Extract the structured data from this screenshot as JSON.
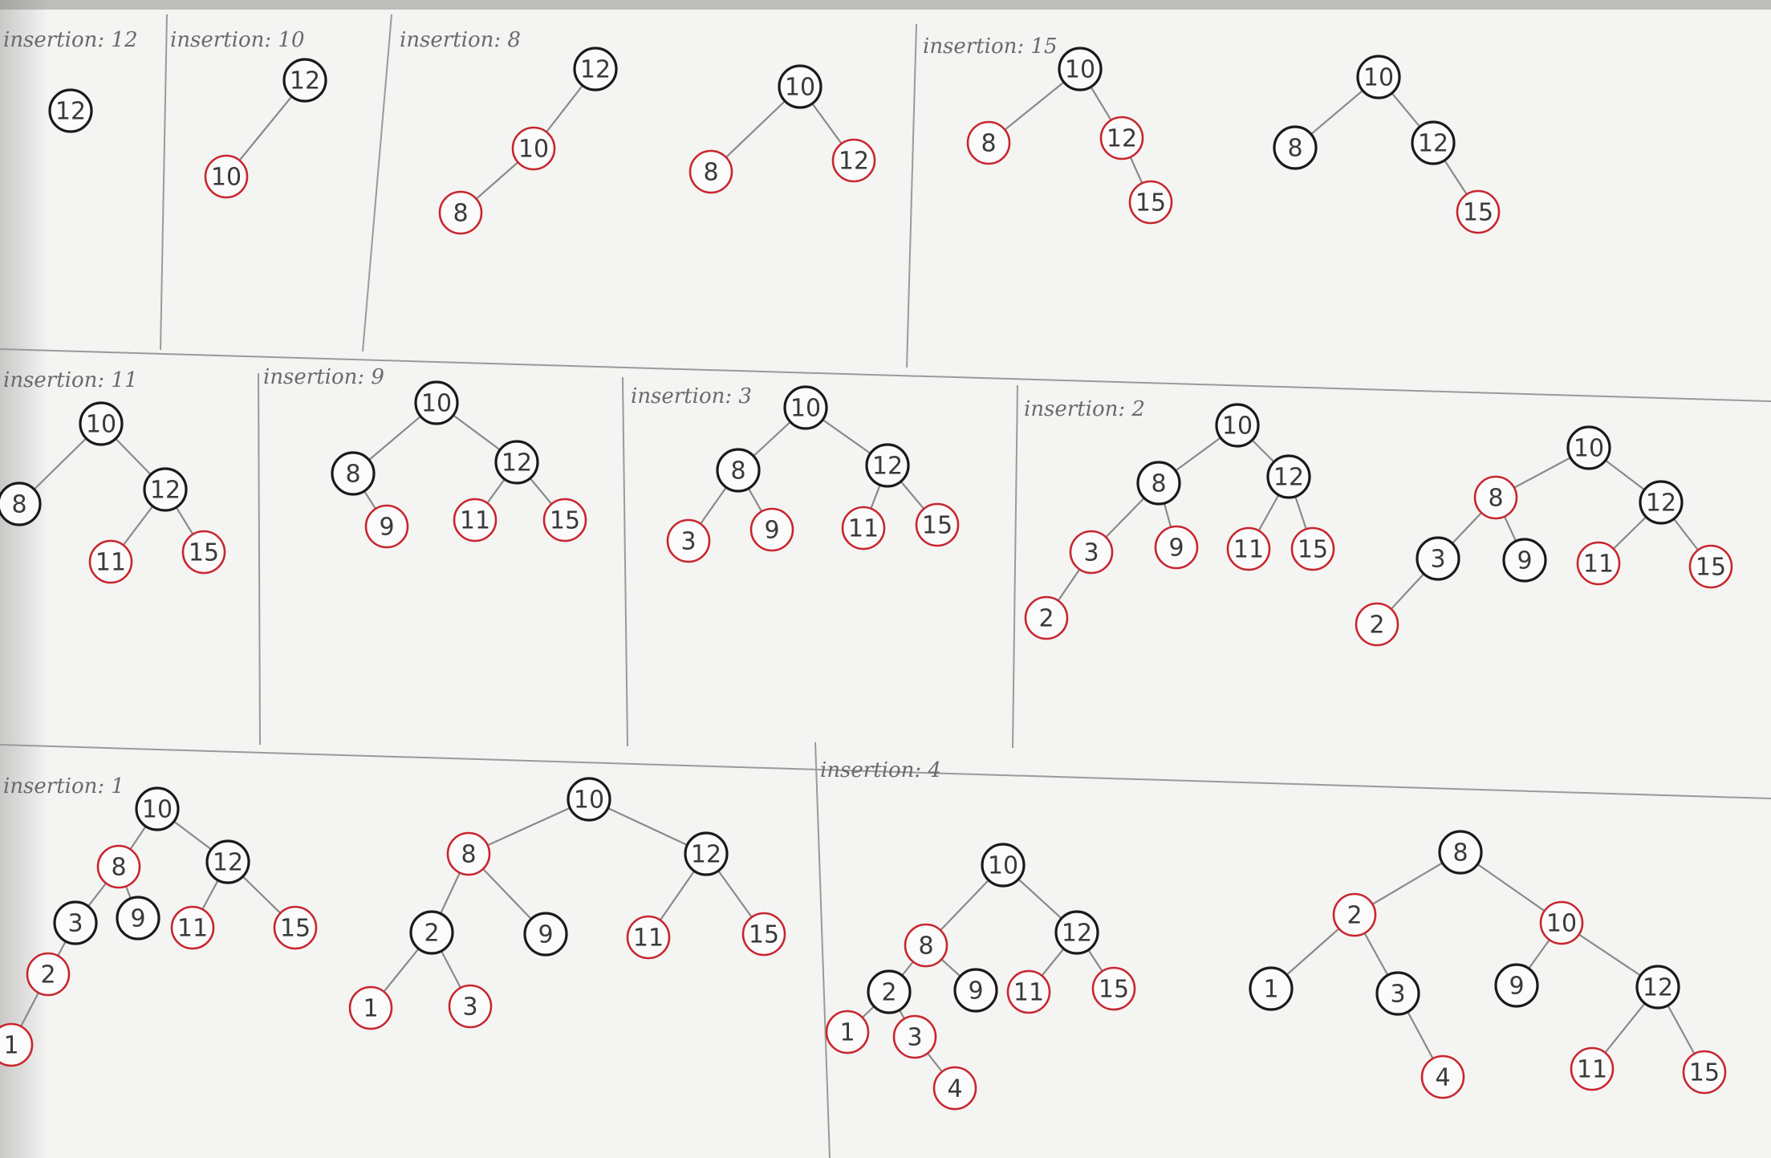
{
  "panels": [
    {
      "label": "insertion: 12",
      "trees": [
        {
          "nodes": [
            {
              "id": "a",
              "v": "12",
              "c": "black"
            }
          ],
          "edges": []
        }
      ]
    },
    {
      "label": "insertion: 10",
      "trees": [
        {
          "nodes": [
            {
              "id": "a",
              "v": "12",
              "c": "black"
            },
            {
              "id": "b",
              "v": "10",
              "c": "red"
            }
          ],
          "edges": [
            [
              "a",
              "b"
            ]
          ]
        }
      ]
    },
    {
      "label": "insertion: 8",
      "trees": [
        {
          "nodes": [
            {
              "id": "a",
              "v": "12",
              "c": "black"
            },
            {
              "id": "b",
              "v": "10",
              "c": "red"
            },
            {
              "id": "c",
              "v": "8",
              "c": "red"
            }
          ],
          "edges": [
            [
              "a",
              "b"
            ],
            [
              "b",
              "c"
            ]
          ]
        },
        {
          "nodes": [
            {
              "id": "a",
              "v": "10",
              "c": "black"
            },
            {
              "id": "b",
              "v": "8",
              "c": "red"
            },
            {
              "id": "c",
              "v": "12",
              "c": "red"
            }
          ],
          "edges": [
            [
              "a",
              "b"
            ],
            [
              "a",
              "c"
            ]
          ]
        }
      ]
    },
    {
      "label": "insertion: 15",
      "trees": [
        {
          "nodes": [
            {
              "id": "a",
              "v": "10",
              "c": "black"
            },
            {
              "id": "b",
              "v": "8",
              "c": "red"
            },
            {
              "id": "c",
              "v": "12",
              "c": "red"
            },
            {
              "id": "d",
              "v": "15",
              "c": "red"
            }
          ],
          "edges": [
            [
              "a",
              "b"
            ],
            [
              "a",
              "c"
            ],
            [
              "c",
              "d"
            ]
          ]
        },
        {
          "nodes": [
            {
              "id": "a",
              "v": "10",
              "c": "black"
            },
            {
              "id": "b",
              "v": "8",
              "c": "black"
            },
            {
              "id": "c",
              "v": "12",
              "c": "black"
            },
            {
              "id": "d",
              "v": "15",
              "c": "red"
            }
          ],
          "edges": [
            [
              "a",
              "b"
            ],
            [
              "a",
              "c"
            ],
            [
              "c",
              "d"
            ]
          ]
        }
      ]
    },
    {
      "label": "insertion: 11",
      "trees": [
        {
          "nodes": [
            {
              "id": "a",
              "v": "10",
              "c": "black"
            },
            {
              "id": "b",
              "v": "8",
              "c": "black"
            },
            {
              "id": "c",
              "v": "12",
              "c": "black"
            },
            {
              "id": "d",
              "v": "11",
              "c": "red"
            },
            {
              "id": "e",
              "v": "15",
              "c": "red"
            }
          ],
          "edges": [
            [
              "a",
              "b"
            ],
            [
              "a",
              "c"
            ],
            [
              "c",
              "d"
            ],
            [
              "c",
              "e"
            ]
          ]
        }
      ]
    },
    {
      "label": "insertion: 9",
      "trees": [
        {
          "nodes": [
            {
              "id": "a",
              "v": "10",
              "c": "black"
            },
            {
              "id": "b",
              "v": "8",
              "c": "black"
            },
            {
              "id": "c",
              "v": "12",
              "c": "black"
            },
            {
              "id": "d",
              "v": "9",
              "c": "red"
            },
            {
              "id": "e",
              "v": "11",
              "c": "red"
            },
            {
              "id": "f",
              "v": "15",
              "c": "red"
            }
          ],
          "edges": [
            [
              "a",
              "b"
            ],
            [
              "a",
              "c"
            ],
            [
              "b",
              "d"
            ],
            [
              "c",
              "e"
            ],
            [
              "c",
              "f"
            ]
          ]
        }
      ]
    },
    {
      "label": "insertion: 3",
      "trees": [
        {
          "nodes": [
            {
              "id": "a",
              "v": "10",
              "c": "black"
            },
            {
              "id": "b",
              "v": "8",
              "c": "black"
            },
            {
              "id": "c",
              "v": "12",
              "c": "black"
            },
            {
              "id": "d",
              "v": "3",
              "c": "red"
            },
            {
              "id": "e",
              "v": "9",
              "c": "red"
            },
            {
              "id": "f",
              "v": "11",
              "c": "red"
            },
            {
              "id": "g",
              "v": "15",
              "c": "red"
            }
          ],
          "edges": [
            [
              "a",
              "b"
            ],
            [
              "a",
              "c"
            ],
            [
              "b",
              "d"
            ],
            [
              "b",
              "e"
            ],
            [
              "c",
              "f"
            ],
            [
              "c",
              "g"
            ]
          ]
        }
      ]
    },
    {
      "label": "insertion: 2",
      "trees": [
        {
          "nodes": [
            {
              "id": "a",
              "v": "10",
              "c": "black"
            },
            {
              "id": "b",
              "v": "8",
              "c": "black"
            },
            {
              "id": "c",
              "v": "12",
              "c": "black"
            },
            {
              "id": "d",
              "v": "3",
              "c": "red"
            },
            {
              "id": "e",
              "v": "9",
              "c": "red"
            },
            {
              "id": "f",
              "v": "11",
              "c": "red"
            },
            {
              "id": "g",
              "v": "15",
              "c": "red"
            },
            {
              "id": "h",
              "v": "2",
              "c": "red"
            }
          ],
          "edges": [
            [
              "a",
              "b"
            ],
            [
              "a",
              "c"
            ],
            [
              "b",
              "d"
            ],
            [
              "b",
              "e"
            ],
            [
              "c",
              "f"
            ],
            [
              "c",
              "g"
            ],
            [
              "d",
              "h"
            ]
          ]
        },
        {
          "nodes": [
            {
              "id": "a",
              "v": "10",
              "c": "black"
            },
            {
              "id": "b",
              "v": "8",
              "c": "red"
            },
            {
              "id": "c",
              "v": "12",
              "c": "black"
            },
            {
              "id": "d",
              "v": "3",
              "c": "black"
            },
            {
              "id": "e",
              "v": "9",
              "c": "black"
            },
            {
              "id": "f",
              "v": "11",
              "c": "red"
            },
            {
              "id": "g",
              "v": "15",
              "c": "red"
            },
            {
              "id": "h",
              "v": "2",
              "c": "red"
            }
          ],
          "edges": [
            [
              "a",
              "b"
            ],
            [
              "a",
              "c"
            ],
            [
              "b",
              "d"
            ],
            [
              "b",
              "e"
            ],
            [
              "c",
              "f"
            ],
            [
              "c",
              "g"
            ],
            [
              "d",
              "h"
            ]
          ]
        }
      ]
    },
    {
      "label": "insertion: 1",
      "trees": [
        {
          "nodes": [
            {
              "id": "a",
              "v": "10",
              "c": "black"
            },
            {
              "id": "b",
              "v": "8",
              "c": "red"
            },
            {
              "id": "c",
              "v": "12",
              "c": "black"
            },
            {
              "id": "d",
              "v": "3",
              "c": "black"
            },
            {
              "id": "e",
              "v": "9",
              "c": "black"
            },
            {
              "id": "f",
              "v": "11",
              "c": "red"
            },
            {
              "id": "g",
              "v": "15",
              "c": "red"
            },
            {
              "id": "h",
              "v": "2",
              "c": "red"
            },
            {
              "id": "i",
              "v": "1",
              "c": "red"
            }
          ],
          "edges": [
            [
              "a",
              "b"
            ],
            [
              "a",
              "c"
            ],
            [
              "b",
              "d"
            ],
            [
              "b",
              "e"
            ],
            [
              "c",
              "f"
            ],
            [
              "c",
              "g"
            ],
            [
              "d",
              "h"
            ],
            [
              "h",
              "i"
            ]
          ]
        },
        {
          "nodes": [
            {
              "id": "a",
              "v": "10",
              "c": "black"
            },
            {
              "id": "b",
              "v": "8",
              "c": "red"
            },
            {
              "id": "c",
              "v": "12",
              "c": "black"
            },
            {
              "id": "d",
              "v": "2",
              "c": "black"
            },
            {
              "id": "e",
              "v": "9",
              "c": "black"
            },
            {
              "id": "f",
              "v": "11",
              "c": "red"
            },
            {
              "id": "g",
              "v": "15",
              "c": "red"
            },
            {
              "id": "h",
              "v": "1",
              "c": "red"
            },
            {
              "id": "i",
              "v": "3",
              "c": "red"
            }
          ],
          "edges": [
            [
              "a",
              "b"
            ],
            [
              "a",
              "c"
            ],
            [
              "b",
              "d"
            ],
            [
              "b",
              "e"
            ],
            [
              "c",
              "f"
            ],
            [
              "c",
              "g"
            ],
            [
              "d",
              "h"
            ],
            [
              "d",
              "i"
            ]
          ]
        }
      ]
    },
    {
      "label": "insertion: 4",
      "trees": [
        {
          "nodes": [
            {
              "id": "a",
              "v": "10",
              "c": "black"
            },
            {
              "id": "b",
              "v": "8",
              "c": "red"
            },
            {
              "id": "c",
              "v": "12",
              "c": "black"
            },
            {
              "id": "d",
              "v": "2",
              "c": "black"
            },
            {
              "id": "e",
              "v": "9",
              "c": "black"
            },
            {
              "id": "f",
              "v": "11",
              "c": "red"
            },
            {
              "id": "g",
              "v": "15",
              "c": "red"
            },
            {
              "id": "h",
              "v": "1",
              "c": "red"
            },
            {
              "id": "i",
              "v": "3",
              "c": "red"
            },
            {
              "id": "j",
              "v": "4",
              "c": "red"
            }
          ],
          "edges": [
            [
              "a",
              "b"
            ],
            [
              "a",
              "c"
            ],
            [
              "b",
              "d"
            ],
            [
              "b",
              "e"
            ],
            [
              "c",
              "f"
            ],
            [
              "c",
              "g"
            ],
            [
              "d",
              "h"
            ],
            [
              "d",
              "i"
            ],
            [
              "i",
              "j"
            ]
          ]
        },
        {
          "nodes": [
            {
              "id": "a",
              "v": "8",
              "c": "black"
            },
            {
              "id": "b",
              "v": "2",
              "c": "red"
            },
            {
              "id": "c",
              "v": "10",
              "c": "red"
            },
            {
              "id": "d",
              "v": "1",
              "c": "black"
            },
            {
              "id": "e",
              "v": "3",
              "c": "black"
            },
            {
              "id": "f",
              "v": "9",
              "c": "black"
            },
            {
              "id": "g",
              "v": "12",
              "c": "black"
            },
            {
              "id": "h",
              "v": "4",
              "c": "red"
            },
            {
              "id": "i",
              "v": "11",
              "c": "red"
            },
            {
              "id": "j",
              "v": "15",
              "c": "red"
            }
          ],
          "edges": [
            [
              "a",
              "b"
            ],
            [
              "a",
              "c"
            ],
            [
              "b",
              "d"
            ],
            [
              "b",
              "e"
            ],
            [
              "c",
              "f"
            ],
            [
              "c",
              "g"
            ],
            [
              "e",
              "h"
            ],
            [
              "g",
              "i"
            ],
            [
              "g",
              "j"
            ]
          ]
        }
      ]
    }
  ],
  "colors": {
    "black_node": "#1a1a1a",
    "red_node": "#c8262e",
    "edge": "#8a8a8a"
  }
}
